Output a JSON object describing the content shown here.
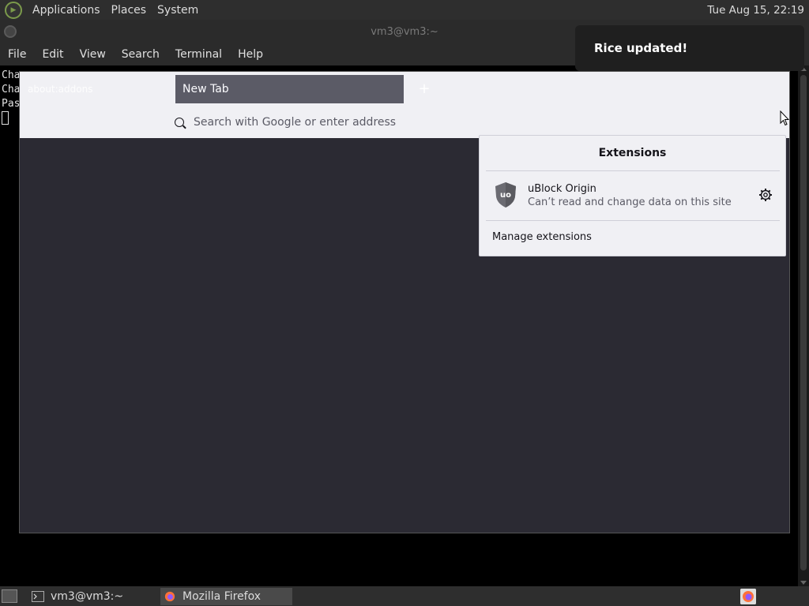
{
  "top_panel": {
    "menus": [
      "Applications",
      "Places",
      "System"
    ],
    "clock": "Tue Aug 15, 22:19",
    "logo_icon": "mate-logo-icon"
  },
  "terminal": {
    "title": "vm3@vm3:~",
    "menus": [
      "File",
      "Edit",
      "View",
      "Search",
      "Terminal",
      "Help"
    ],
    "lines": [
      "Cha",
      "Cha",
      "Pas"
    ]
  },
  "firefox": {
    "side_text": "about:addons",
    "tab_title": "New Tab",
    "new_tab_label": "+",
    "url_placeholder": "Search with Google or enter address"
  },
  "extensions_panel": {
    "title": "Extensions",
    "items": [
      {
        "name": "uBlock Origin",
        "description": "Can’t read and change data on this site",
        "icon": "ublock-origin-shield-icon"
      }
    ],
    "manage_label": "Manage extensions"
  },
  "notification": {
    "text": "Rice updated!"
  },
  "bottom_panel": {
    "tasks": [
      {
        "label": "vm3@vm3:~",
        "icon": "terminal-icon"
      },
      {
        "label": "Mozilla Firefox",
        "icon": "firefox-icon"
      }
    ]
  },
  "colors": {
    "panel_bg": "#2e2e2e",
    "firefox_toolbar": "#f0f0f4",
    "firefox_content": "#2b2a33",
    "tab_active": "#5b5b66"
  }
}
